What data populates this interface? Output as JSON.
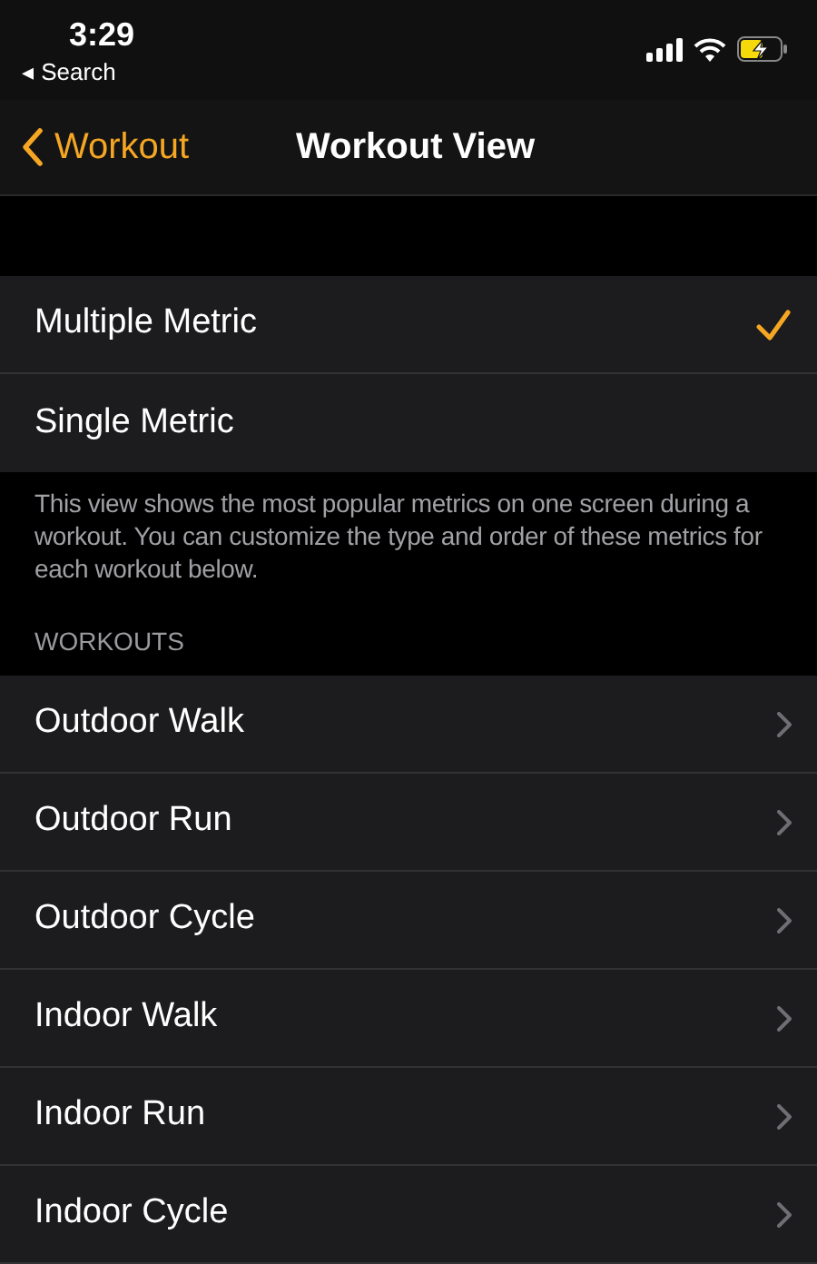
{
  "status_bar": {
    "time": "3:29",
    "back_link": "◂ Search"
  },
  "nav": {
    "back": "Workout",
    "title": "Workout View"
  },
  "view_options": [
    {
      "label": "Multiple Metric",
      "selected": true
    },
    {
      "label": "Single Metric",
      "selected": false
    }
  ],
  "footer": "This view shows the most popular metrics on one screen during a workout. You can customize the type and order of these metrics for each workout below.",
  "workouts": {
    "header": "WORKOUTS",
    "items": [
      {
        "label": "Outdoor Walk"
      },
      {
        "label": "Outdoor Run"
      },
      {
        "label": "Outdoor Cycle"
      },
      {
        "label": "Indoor Walk"
      },
      {
        "label": "Indoor Run"
      },
      {
        "label": "Indoor Cycle"
      }
    ]
  }
}
